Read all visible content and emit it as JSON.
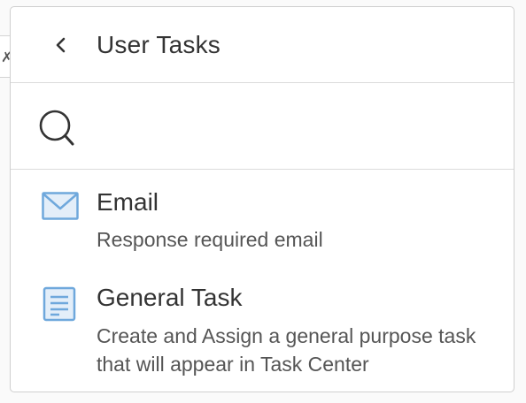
{
  "panel": {
    "title": "User Tasks",
    "back_icon": "chevron-left-icon"
  },
  "search": {
    "icon": "search-icon",
    "value": "",
    "placeholder": ""
  },
  "items": [
    {
      "title": "Email",
      "description": "Response required email",
      "icon": "envelope-icon"
    },
    {
      "title": "General Task",
      "description": "Create and Assign a general purpose task that will appear in Task Center",
      "icon": "document-icon"
    }
  ],
  "colors": {
    "icon_blue": "#6fa8dc",
    "icon_fill": "#e3eef9",
    "text": "#333333",
    "subtext": "#555555",
    "divider": "#dcdcdc"
  }
}
